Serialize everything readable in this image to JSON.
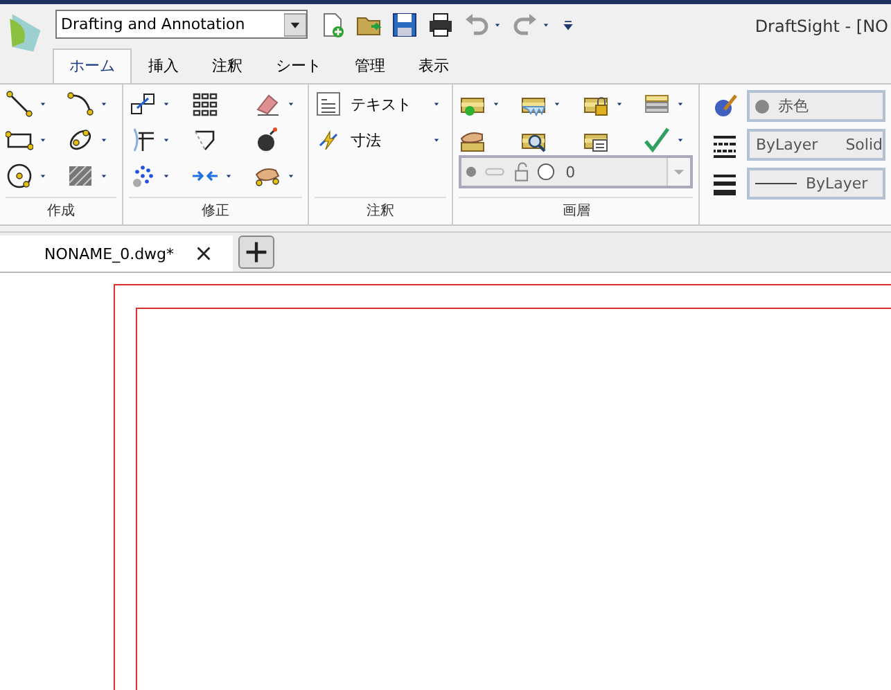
{
  "workspace": {
    "value": "Drafting and Annotation"
  },
  "quick_access": [
    {
      "dropdown": false
    },
    {
      "dropdown": false
    },
    {
      "dropdown": false
    },
    {
      "dropdown": false
    },
    {
      "dropdown": true
    },
    {
      "dropdown": true
    },
    {
      "dropdown": false
    }
  ],
  "title": "DraftSight - [NO",
  "tabs": [
    {
      "label": "ホーム",
      "selected": true
    },
    {
      "label": "挿入",
      "selected": false
    },
    {
      "label": "注釈",
      "selected": false
    },
    {
      "label": "シート",
      "selected": false
    },
    {
      "label": "管理",
      "selected": false
    },
    {
      "label": "表示",
      "selected": false
    }
  ],
  "panels": [
    {
      "label": "作成",
      "tools": [
        {
          "dropdown": true
        },
        {
          "dropdown": true
        },
        {
          "dropdown": true
        },
        {
          "dropdown": true
        },
        {
          "dropdown": true
        },
        {
          "dropdown": true
        }
      ]
    },
    {
      "label": "修正",
      "tools": [
        {
          "dropdown": true
        },
        {
          "dropdown": false
        },
        {
          "dropdown": true
        },
        {
          "dropdown": true
        },
        {
          "dropdown": false
        },
        {
          "dropdown": false
        },
        {
          "dropdown": true
        },
        {
          "dropdown": true
        },
        {
          "dropdown": true
        }
      ]
    },
    {
      "label": "注釈",
      "tools": [
        {
          "label": "テキスト",
          "dropdown": true
        },
        {
          "label": "寸法",
          "dropdown": true
        }
      ]
    },
    {
      "label": "画層",
      "tools": [
        {
          "dropdown": true
        },
        {
          "dropdown": true
        },
        {
          "dropdown": true
        },
        {
          "dropdown": true
        },
        {
          "dropdown": false
        },
        {
          "dropdown": false
        },
        {
          "dropdown": false
        },
        {
          "dropdown": true
        }
      ],
      "layer_combo": {
        "value": "0"
      }
    }
  ],
  "properties": {
    "color_name": "赤色",
    "linetype": "ByLayer",
    "line_style": "Solid",
    "lineweight": "ByLayer"
  },
  "doc_tabs": [
    {
      "label": "NONAME_0.dwg*",
      "selected": true
    }
  ]
}
